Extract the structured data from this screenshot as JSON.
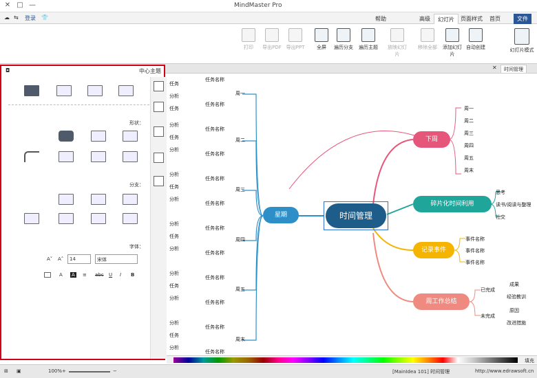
{
  "app_title": "MindMaster Pro",
  "window": {
    "minimize": "—",
    "maximize": "□",
    "close": "✕"
  },
  "user_label": "登录",
  "tabs": [
    "文件",
    "首页",
    "页面样式",
    "幻灯片",
    "高级",
    "帮助"
  ],
  "ribbon": {
    "buttons": [
      {
        "label": "幻灯片模式",
        "disabled": false,
        "big": true
      },
      {
        "label": "自动创建",
        "disabled": false
      },
      {
        "label": "添加幻灯片",
        "disabled": false
      },
      {
        "label": "移除全部",
        "disabled": true
      },
      {
        "label": "放映幻灯片",
        "disabled": true
      },
      {
        "label": "遍历主题",
        "disabled": false
      },
      {
        "label": "遍历分支",
        "disabled": false
      },
      {
        "label": "全屏",
        "disabled": false
      },
      {
        "label": "导出PPT",
        "disabled": true
      },
      {
        "label": "导出PDF",
        "disabled": true
      },
      {
        "label": "打印",
        "disabled": true
      }
    ]
  },
  "doc_tab": "时间管理",
  "side": {
    "header": "中心主题",
    "section_shape": "形状：",
    "section_branch": "分支：",
    "section_font": "字体：",
    "font_name": "宋体",
    "font_size": "14",
    "font_btns": [
      "B",
      "I",
      "U",
      "abc",
      "A",
      "A"
    ]
  },
  "map": {
    "central": "时间管理",
    "weekday": "星期",
    "days": [
      "周一",
      "周二",
      "周三",
      "周四",
      "周五",
      "周末"
    ],
    "task_name": "任务名称",
    "item": "任务",
    "sub": "分析",
    "right_nodes": [
      {
        "label": "下周",
        "color": "#e6557a",
        "subs": [
          "周一",
          "周二",
          "周三",
          "周四",
          "周五",
          "周末"
        ]
      },
      {
        "label": "碎片化时间利用",
        "color": "#1fa59a",
        "subs": [
          "思考",
          "读书/阅读与整理",
          "社交"
        ]
      },
      {
        "label": "记录事件",
        "color": "#f5b400",
        "subs": [
          "事件名称",
          "事件名称",
          "事件名称"
        ]
      },
      {
        "label": "周工作总结",
        "color": "#ef8a80",
        "subs": [
          "已完成",
          "未完成"
        ],
        "leaf": [
          "成果",
          "经验教训",
          "原因",
          "改进措施"
        ]
      }
    ]
  },
  "status": {
    "url": "http://www.edrawsoft.cn",
    "info": "[MainIdea 101] 时间管理",
    "zoom": "100%"
  },
  "palette_label": "填充",
  "colors": {
    "accent": "#2b5797",
    "central": "#1e5c8a",
    "weekday": "#2e8fc8"
  }
}
